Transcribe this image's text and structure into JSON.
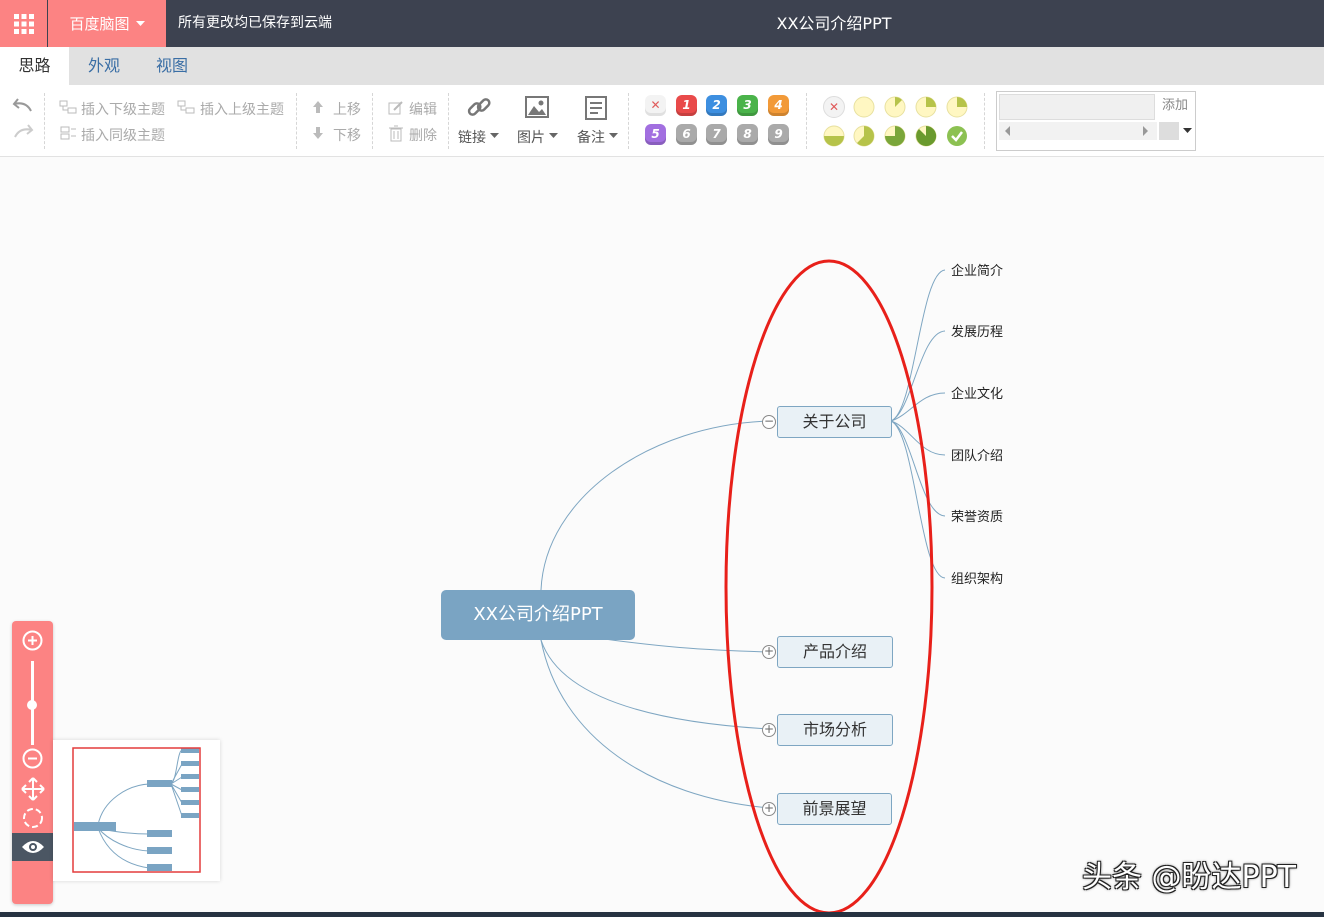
{
  "topbar": {
    "apps_icon": "grid-icon",
    "brand_label": "百度脑图",
    "save_status": "所有更改均已保存到云端",
    "doc_title": "XX公司介绍PPT"
  },
  "tabs": [
    {
      "label": "思路",
      "active": true
    },
    {
      "label": "外观",
      "active": false
    },
    {
      "label": "视图",
      "active": false
    }
  ],
  "toolbar": {
    "insert_child": "插入下级主题",
    "insert_parent": "插入上级主题",
    "insert_sibling": "插入同级主题",
    "move_up": "上移",
    "move_down": "下移",
    "edit": "编辑",
    "delete": "删除",
    "link": "链接",
    "image": "图片",
    "note": "备注",
    "priorities": [
      "1",
      "2",
      "3",
      "4",
      "5",
      "6",
      "7",
      "8",
      "9"
    ],
    "tag_add": "添加"
  },
  "colors": {
    "topbar_bg": "#3d4250",
    "accent": "#fc8383",
    "root_bg": "#7aa4c3",
    "node_border": "#7ea6c2",
    "highlight_ellipse": "#e8201a"
  },
  "mindmap": {
    "root": "XX公司介绍PPT",
    "branches": [
      {
        "label": "关于公司",
        "expanded": true,
        "children": [
          "企业简介",
          "发展历程",
          "企业文化",
          "团队介绍",
          "荣誉资质",
          "组织架构"
        ]
      },
      {
        "label": "产品介绍",
        "expanded": false
      },
      {
        "label": "市场分析",
        "expanded": false
      },
      {
        "label": "前景展望",
        "expanded": false
      }
    ]
  },
  "watermark": "头条 @盼达PPT"
}
